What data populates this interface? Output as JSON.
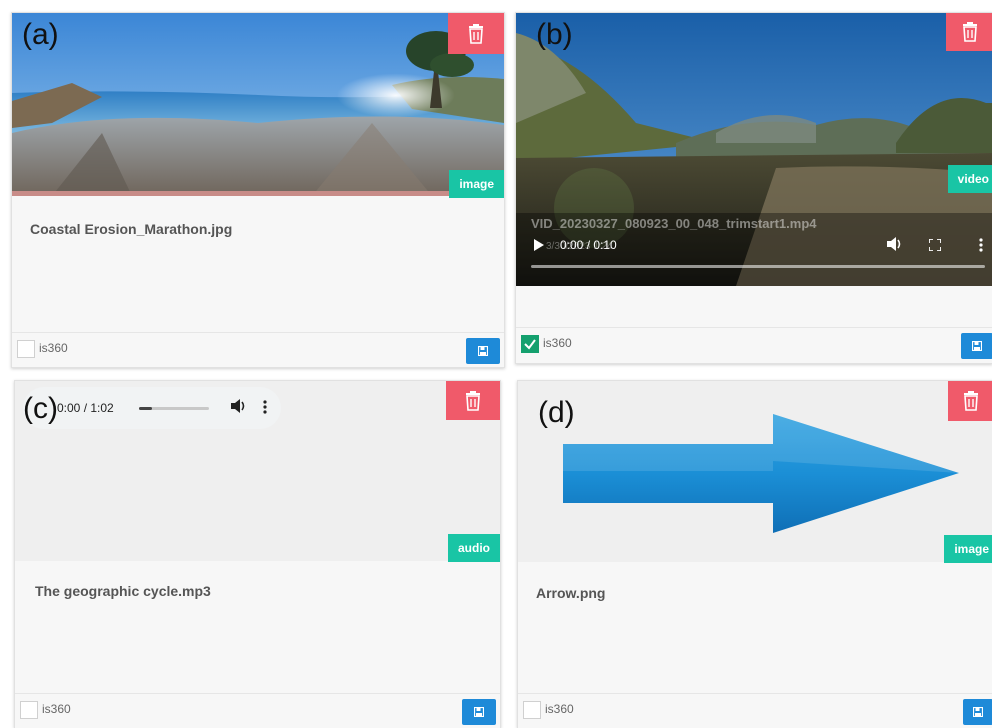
{
  "cards": [
    {
      "panel": "(a)",
      "type": "image",
      "filename": "Coastal Erosion_Marathon.jpg",
      "checkbox_label": "is360",
      "checked": false
    },
    {
      "panel": "(b)",
      "type": "video",
      "filename": "VID_20230327_080923_00_048_trimstart1.mp4",
      "time": "0:00 / 0:10",
      "date_overlay": "3/30/2023 1:24",
      "checkbox_label": "is360",
      "checked": true
    },
    {
      "panel": "(c)",
      "type": "audio",
      "filename": "The geographic cycle.mp3",
      "time": "0:00 / 1:02",
      "progress": 0.18,
      "checkbox_label": "is360",
      "checked": false
    },
    {
      "panel": "(d)",
      "type": "image",
      "filename": "Arrow.png",
      "checkbox_label": "is360",
      "checked": false
    }
  ],
  "colors": {
    "delete": "#f05a6a",
    "badge": "#19c5a5",
    "save": "#1e8ad8",
    "checked": "#14a06e"
  },
  "icons": {
    "delete": "trash-icon",
    "save": "floppy-disk-icon",
    "check": "checkmark-icon"
  }
}
